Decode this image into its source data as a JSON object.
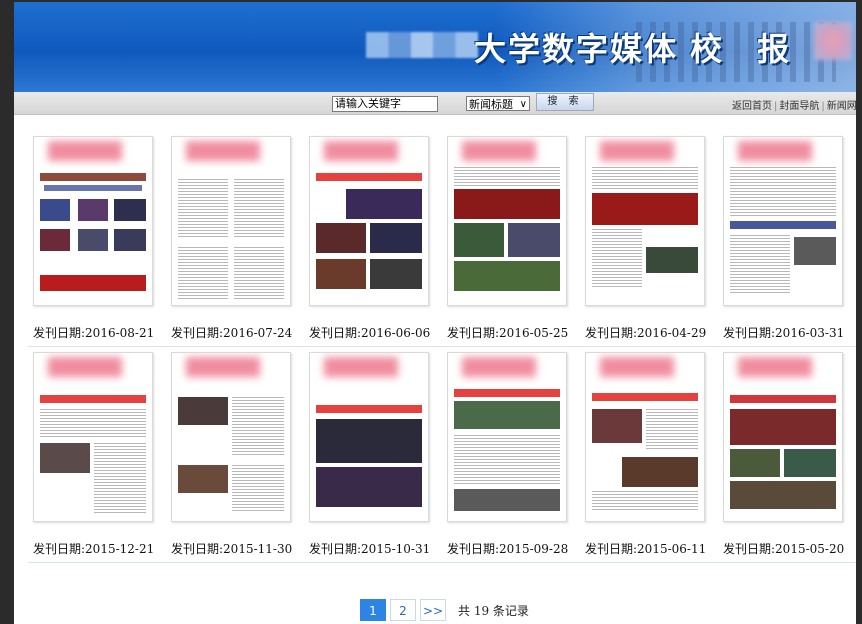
{
  "banner": {
    "title": "大学数字媒体",
    "title_big": "校 报"
  },
  "toolbar": {
    "search_placeholder": "请输入关键字",
    "select_value": "新闻标题",
    "search_button": "搜 索",
    "links": [
      "返回首页",
      "封面导航",
      "新闻网"
    ]
  },
  "issues": [
    {
      "date_label": "发刊日期:2016-08-21"
    },
    {
      "date_label": "发刊日期:2016-07-24"
    },
    {
      "date_label": "发刊日期:2016-06-06"
    },
    {
      "date_label": "发刊日期:2016-05-25"
    },
    {
      "date_label": "发刊日期:2016-04-29"
    },
    {
      "date_label": "发刊日期:2016-03-31"
    },
    {
      "date_label": "发刊日期:2015-12-21"
    },
    {
      "date_label": "发刊日期:2015-11-30"
    },
    {
      "date_label": "发刊日期:2015-10-31"
    },
    {
      "date_label": "发刊日期:2015-09-28"
    },
    {
      "date_label": "发刊日期:2015-06-11"
    },
    {
      "date_label": "发刊日期:2015-05-20"
    }
  ],
  "pagination": {
    "pages": [
      "1",
      "2"
    ],
    "next": ">>",
    "total": "共 19 条记录",
    "current": "1"
  },
  "colors": {
    "banner_blue": "#0f59bd",
    "active_page": "#2d84e4"
  }
}
